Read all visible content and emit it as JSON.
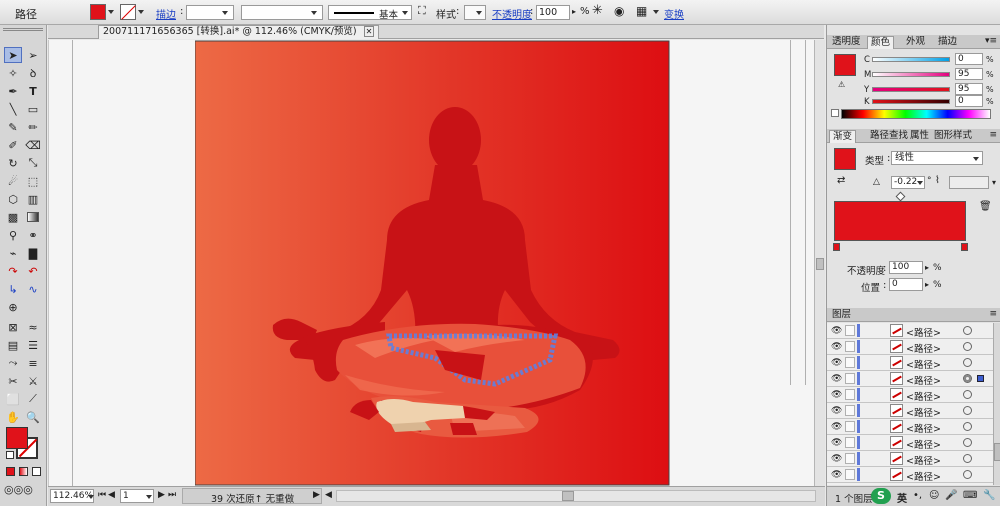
{
  "control_bar": {
    "object_type": "路径",
    "fill_color": "#e0121a",
    "stroke_label": "描边",
    "stroke_profile": "基本",
    "style_label": "样式",
    "opacity_label": "不透明度",
    "opacity_value": "100",
    "opacity_unit": "%",
    "transform_label": "变换"
  },
  "document": {
    "tab_title": "200711171656365 [转换].ai* @ 112.46% (CMYK/预览)"
  },
  "status_bar": {
    "zoom": "112.46%",
    "page": "1",
    "undo_status": "39 次还原↑ 无重做"
  },
  "color_panel": {
    "tabs": [
      "透明度",
      "颜色",
      "外观",
      "描边"
    ],
    "active_tab": "颜色",
    "swatch": "#e0121a",
    "channels": [
      {
        "label": "C",
        "value": "0"
      },
      {
        "label": "M",
        "value": "95"
      },
      {
        "label": "Y",
        "value": "95"
      },
      {
        "label": "K",
        "value": "0"
      }
    ]
  },
  "gradient_panel": {
    "tabs": [
      "渐变",
      "路径查找",
      "属性",
      "图形样式"
    ],
    "type_label": "类型",
    "type_value": "线性",
    "angle_value": "-0.22",
    "angle_unit": "°",
    "opacity_label": "不透明度",
    "opacity_value": "100",
    "opacity_unit": "%",
    "location_label": "位置",
    "location_value": "0",
    "location_unit": "%",
    "bar_color": "#e0121a"
  },
  "layers_panel": {
    "tab": "图层",
    "rows": [
      {
        "name": "<路径>",
        "selected": false
      },
      {
        "name": "<路径>",
        "selected": false
      },
      {
        "name": "<路径>",
        "selected": false
      },
      {
        "name": "<路径>",
        "selected": true
      },
      {
        "name": "<路径>",
        "selected": false
      },
      {
        "name": "<路径>",
        "selected": false
      },
      {
        "name": "<路径>",
        "selected": false
      },
      {
        "name": "<路径>",
        "selected": false
      },
      {
        "name": "<路径>",
        "selected": false
      },
      {
        "name": "<路径>",
        "selected": false
      }
    ],
    "footer": "1 个图层",
    "ime_badge": "S",
    "ime_label": "英"
  }
}
